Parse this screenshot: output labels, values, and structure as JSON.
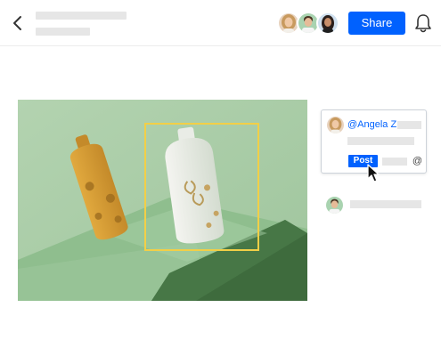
{
  "header": {
    "back_icon": "chevron-left-icon",
    "share_label": "Share",
    "bell_icon": "bell-icon",
    "collaborators": [
      {
        "icon": "avatar-woman-blonde"
      },
      {
        "icon": "avatar-man"
      },
      {
        "icon": "avatar-woman-dark-hair"
      }
    ]
  },
  "preview": {
    "annotation_color": "#f2cf47",
    "background_color": "#a9cca8"
  },
  "comment_card": {
    "mention": "@Angela Z",
    "post_label": "Post",
    "at_label": "@"
  },
  "colors": {
    "accent": "#0061fe",
    "placeholder": "#e6e6e6"
  }
}
